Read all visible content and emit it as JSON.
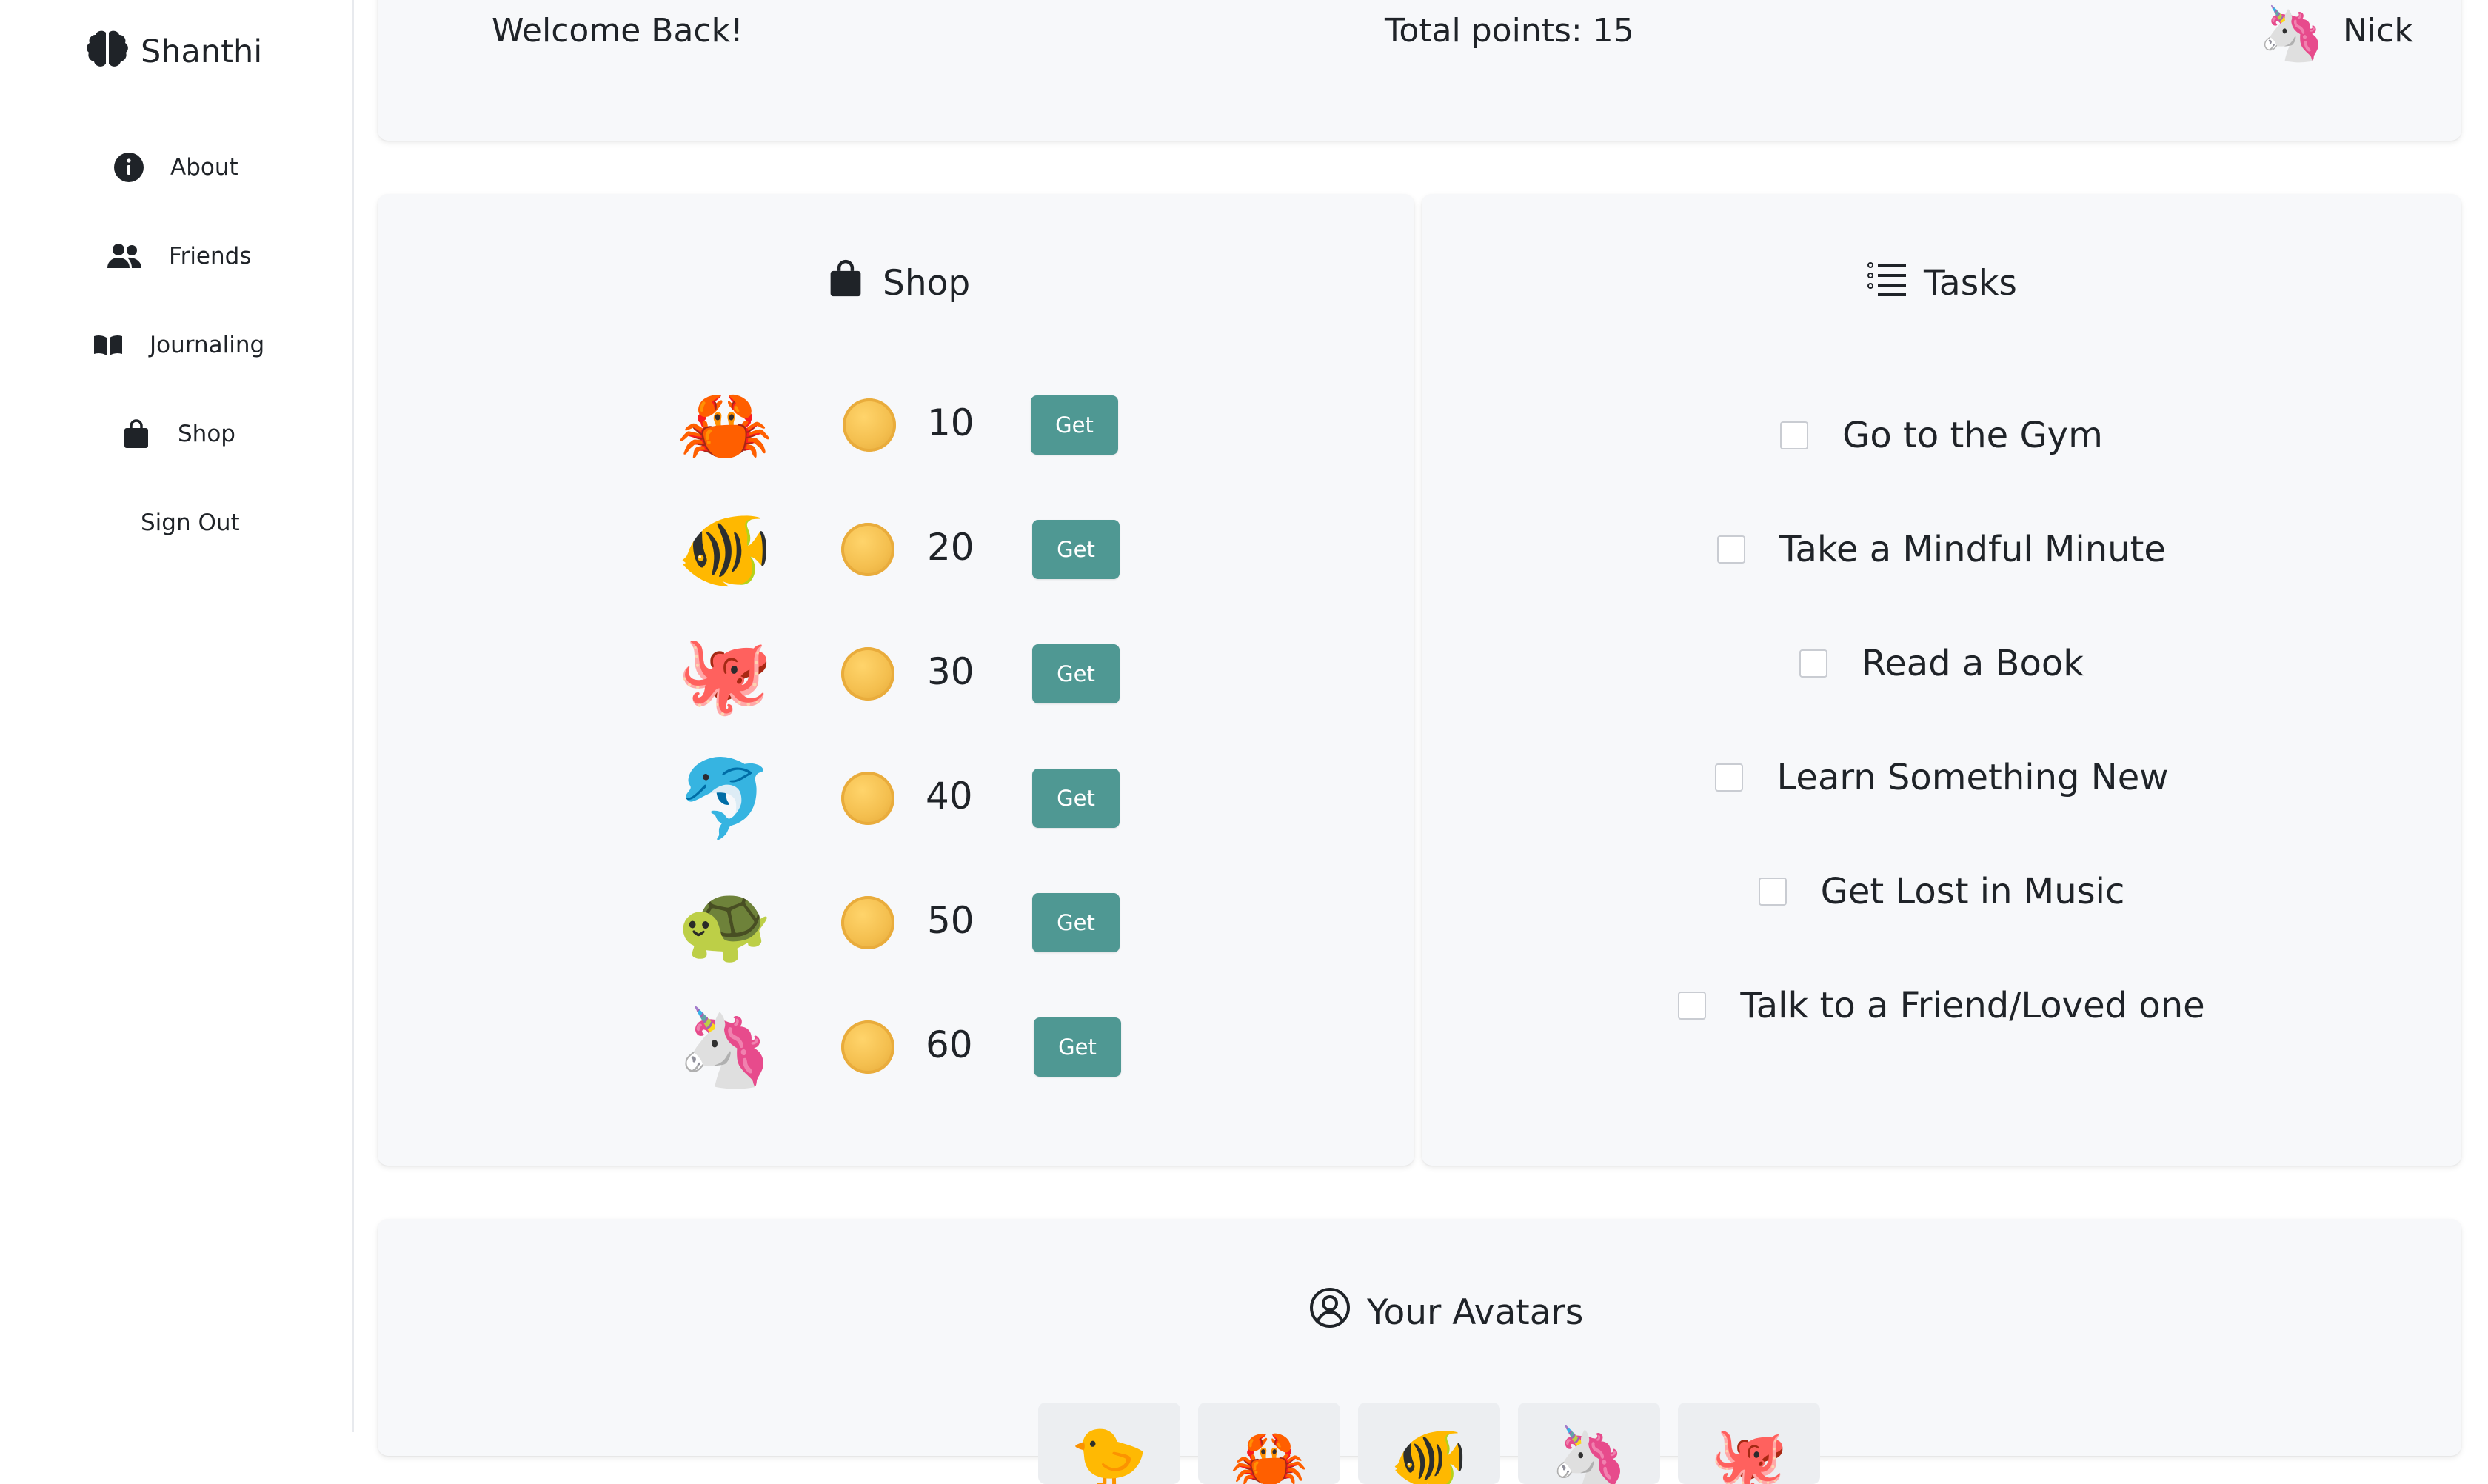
{
  "app": {
    "name": "Shanthi"
  },
  "sidebar": {
    "items": [
      {
        "label": "About",
        "icon": "info-circle-icon"
      },
      {
        "label": "Friends",
        "icon": "people-icon"
      },
      {
        "label": "Journaling",
        "icon": "open-book-icon"
      },
      {
        "label": "Shop",
        "icon": "shopping-bag-icon"
      },
      {
        "label": "Sign Out",
        "icon": ""
      }
    ]
  },
  "header": {
    "greeting": "Welcome Back!",
    "points": "Total points: 15",
    "user_name": "Nick",
    "user_avatar": "🦄"
  },
  "shop": {
    "title": "Shop",
    "items": [
      {
        "emoji": "🦀",
        "price": "10",
        "button": "Get"
      },
      {
        "emoji": "🐠",
        "price": "20",
        "button": "Get"
      },
      {
        "emoji": "🐙",
        "price": "30",
        "button": "Get"
      },
      {
        "emoji": "🐬",
        "price": "40",
        "button": "Get"
      },
      {
        "emoji": "🐢",
        "price": "50",
        "button": "Get"
      },
      {
        "emoji": "🦄",
        "price": "60",
        "button": "Get"
      }
    ]
  },
  "tasks": {
    "title": "Tasks",
    "items": [
      {
        "label": "Go to the Gym",
        "checked": false
      },
      {
        "label": "Take a Mindful Minute",
        "checked": false
      },
      {
        "label": "Read a Book",
        "checked": false
      },
      {
        "label": "Learn Something New",
        "checked": false
      },
      {
        "label": "Get Lost in Music",
        "checked": false
      },
      {
        "label": "Talk to a Friend/Loved one",
        "checked": false
      }
    ]
  },
  "avatars": {
    "title": "Your Avatars",
    "items": [
      "🐤",
      "🦀",
      "🐠",
      "🦄",
      "🐙"
    ]
  },
  "colors": {
    "accent_button": "#4f9893",
    "card_background": "#f7f8fa",
    "coin": "#f4bf4f"
  }
}
